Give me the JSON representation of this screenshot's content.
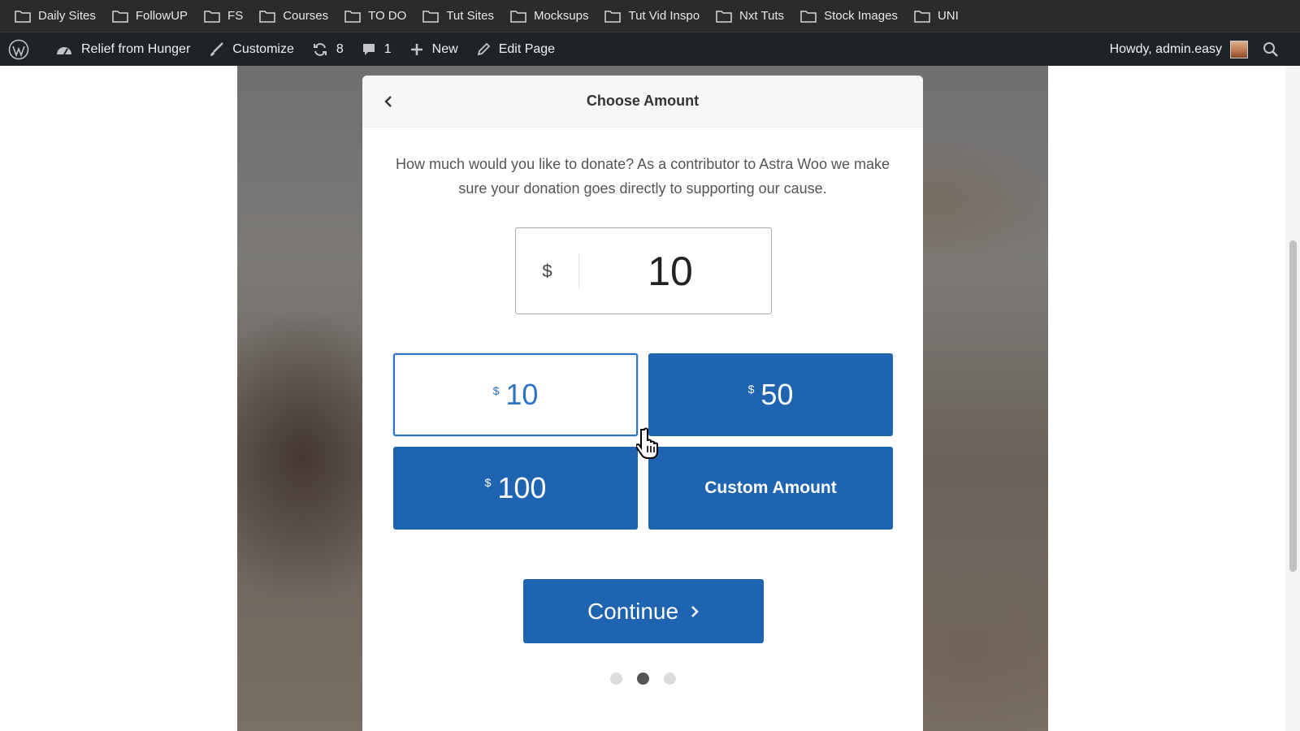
{
  "bookmarks": [
    {
      "label": "Daily Sites"
    },
    {
      "label": "FollowUP"
    },
    {
      "label": "FS"
    },
    {
      "label": "Courses"
    },
    {
      "label": "TO DO"
    },
    {
      "label": "Tut Sites"
    },
    {
      "label": "Mocksups"
    },
    {
      "label": "Tut Vid Inspo"
    },
    {
      "label": "Nxt Tuts"
    },
    {
      "label": "Stock Images"
    },
    {
      "label": "UNI"
    }
  ],
  "adminbar": {
    "site_name": "Relief from Hunger",
    "customize": "Customize",
    "updates_count": "8",
    "comments_count": "1",
    "new_label": "New",
    "edit_page": "Edit Page",
    "howdy": "Howdy, admin.easy"
  },
  "modal": {
    "title": "Choose Amount",
    "description": "How much would you like to donate? As a contributor to Astra Woo we make sure your donation goes directly to supporting our cause.",
    "currency_symbol": "$",
    "amount_value": "10",
    "options": [
      {
        "currency": "$",
        "amount": "10",
        "selected": true
      },
      {
        "currency": "$",
        "amount": "50",
        "selected": false
      },
      {
        "currency": "$",
        "amount": "100",
        "selected": false
      }
    ],
    "custom_label": "Custom Amount",
    "continue_label": "Continue",
    "steps_total": 3,
    "active_step": 2
  },
  "colors": {
    "primary": "#1f64b0",
    "admin_bar": "#1d2327",
    "bookmarks_bar": "#2b2b2d"
  }
}
